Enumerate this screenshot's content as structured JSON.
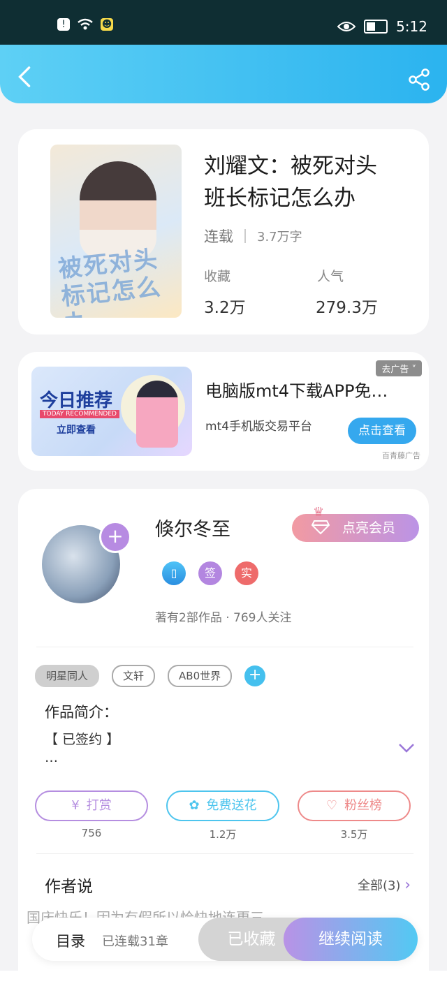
{
  "status_bar": {
    "time": "5:12"
  },
  "book": {
    "title_line1": "刘耀文：被死对头",
    "title_line2": "班长标记怎么办",
    "status": "连载",
    "words": "3.7万字",
    "favorites_label": "收藏",
    "favorites_value": "3.2万",
    "popularity_label": "人气",
    "popularity_value": "279.3万",
    "cover_text": "被死对头标记怎么办"
  },
  "ad": {
    "image_title": "今日推荐",
    "image_subtitle": "TODAY RECOMMENDED",
    "image_cta": "立即查看",
    "close_label": "去广告",
    "title": "电脑版mt4下载APP免…",
    "subtitle": "mt4手机版交易平台",
    "button": "点击查看",
    "source": "百青藤广告"
  },
  "author": {
    "name": "倏尔冬至",
    "vip_button": "点亮会员",
    "badge_sign": "签",
    "badge_real": "实",
    "info": "著有2部作品 · 769人关注",
    "tags": [
      "明星同人",
      "文轩",
      "AB0世界"
    ],
    "intro_heading": "作品简介：",
    "intro_text": "【 已签约 】",
    "intro_more": "…",
    "actions": [
      {
        "label": "打赏",
        "count": "756",
        "color": "#b58ee0"
      },
      {
        "label": "免费送花",
        "count": "1.2万",
        "color": "#4ec5ee"
      },
      {
        "label": "粉丝榜",
        "count": "3.5万",
        "color": "#ee8a8a"
      }
    ],
    "says_heading": "作者说",
    "says_all": "全部(3)",
    "says_preview": "国庆快乐！因为有假所以恰快地连更三"
  },
  "bottom_bar": {
    "menu": "目录",
    "chapters": "已连载31章",
    "favorited": "已收藏",
    "continue": "继续阅读"
  }
}
